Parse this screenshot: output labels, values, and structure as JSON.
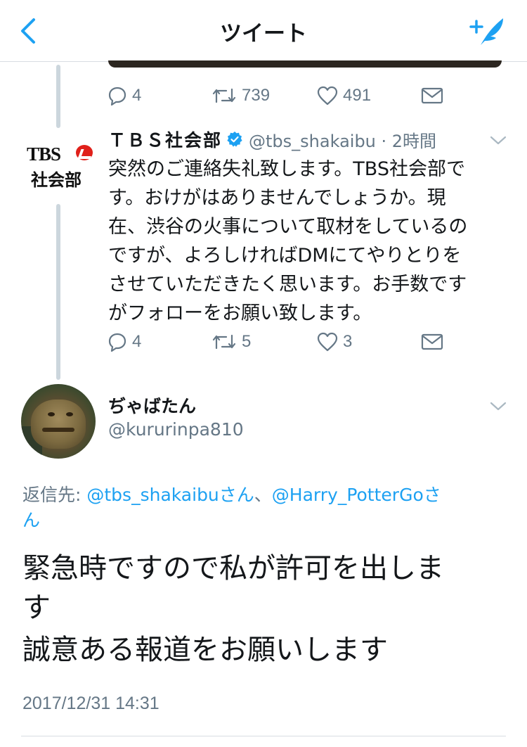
{
  "header": {
    "title": "ツイート",
    "back_icon": "chevron-left-icon",
    "compose_icon": "compose-tweet-icon"
  },
  "prev_tweet": {
    "actions": {
      "replies": "4",
      "retweets": "739",
      "likes": "491"
    }
  },
  "tbs_tweet": {
    "avatar_text_top": "TBS",
    "avatar_text_bottom": "社会部",
    "name": "ＴＢＳ社会部",
    "verified_icon": "verified-badge-icon",
    "handle_time": "@tbs_shakaibu · 2時間",
    "lines": [
      "突然のご連絡失礼致します。TBS社会部で",
      "す。おけがはありませんでしょうか。現",
      "在、渋谷の火事について取材をしているの",
      "ですが、よろしければDMにてやりとりを",
      "させていただきたく思います。お手数です",
      "がフォローをお願い致します。"
    ],
    "actions": {
      "replies": "4",
      "retweets": "5",
      "likes": "3"
    }
  },
  "reply": {
    "name": "ぢゃばたん",
    "handle": "@kururinpa810",
    "reply_label": "返信先: ",
    "mention_1": "@tbs_shakaibuさん",
    "separator": "、",
    "mention_2_line1": "@Harry_PotterGoさ",
    "mention_2_line2": "ん",
    "text_lines": [
      "緊急時ですので私が許可を出しま",
      "す",
      "誠意ある報道をお願いします"
    ],
    "timestamp": "2017/12/31 14:31"
  },
  "colors": {
    "accent": "#1da1f2",
    "secondary_text": "#657786",
    "divider": "#d8dde2",
    "thread_line": "#ccd6dd"
  }
}
